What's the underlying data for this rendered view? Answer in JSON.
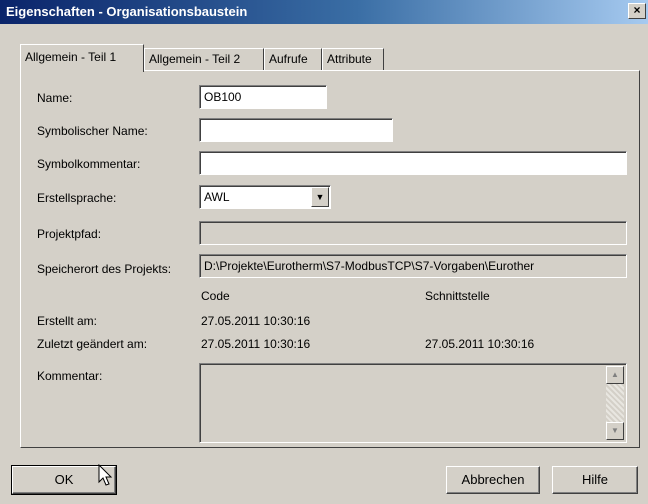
{
  "window": {
    "title": "Eigenschaften - Organisationsbaustein",
    "close_label": "×"
  },
  "tabs": [
    {
      "label": "Allgemein - Teil 1",
      "active": true
    },
    {
      "label": "Allgemein - Teil 2",
      "active": false
    },
    {
      "label": "Aufrufe",
      "active": false
    },
    {
      "label": "Attribute",
      "active": false
    }
  ],
  "form": {
    "name_label": "Name:",
    "name_value": "OB100",
    "symbolic_name_label": "Symbolischer Name:",
    "symbolic_name_value": "",
    "symbol_comment_label": "Symbolkommentar:",
    "symbol_comment_value": "",
    "language_label": "Erstellsprache:",
    "language_value": "AWL",
    "project_path_label": "Projektpfad:",
    "project_path_value": "",
    "storage_label": "Speicherort des Projekts:",
    "storage_value": "D:\\Projekte\\Eurotherm\\S7-ModbusTCP\\S7-Vorgaben\\Eurother",
    "col_code": "Code",
    "col_interface": "Schnittstelle",
    "created_label": "Erstellt am:",
    "created_code": "27.05.2011 10:30:16",
    "modified_label": "Zuletzt geändert am:",
    "modified_code": "27.05.2011 10:30:16",
    "modified_interface": "27.05.2011 10:30:16",
    "comment_label": "Kommentar:",
    "comment_value": ""
  },
  "buttons": {
    "ok": "OK",
    "cancel": "Abbrechen",
    "help": "Hilfe"
  }
}
